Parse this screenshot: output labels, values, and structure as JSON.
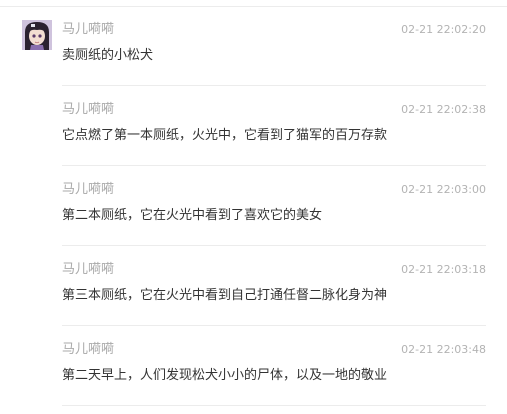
{
  "messages": [
    {
      "user": "马儿嗬嗬",
      "time": "02-21 22:02:20",
      "text": "卖厕纸的小松犬"
    },
    {
      "user": "马儿嗬嗬",
      "time": "02-21 22:02:38",
      "text": "它点燃了第一本厕纸，火光中，它看到了猫军的百万存款"
    },
    {
      "user": "马儿嗬嗬",
      "time": "02-21 22:03:00",
      "text": "第二本厕纸，它在火光中看到了喜欢它的美女"
    },
    {
      "user": "马儿嗬嗬",
      "time": "02-21 22:03:18",
      "text": "第三本厕纸，它在火光中看到自己打通任督二脉化身为神"
    },
    {
      "user": "马儿嗬嗬",
      "time": "02-21 22:03:48",
      "text": "第二天早上，人们发现松犬小小的尸体，以及一地的敬业"
    }
  ]
}
